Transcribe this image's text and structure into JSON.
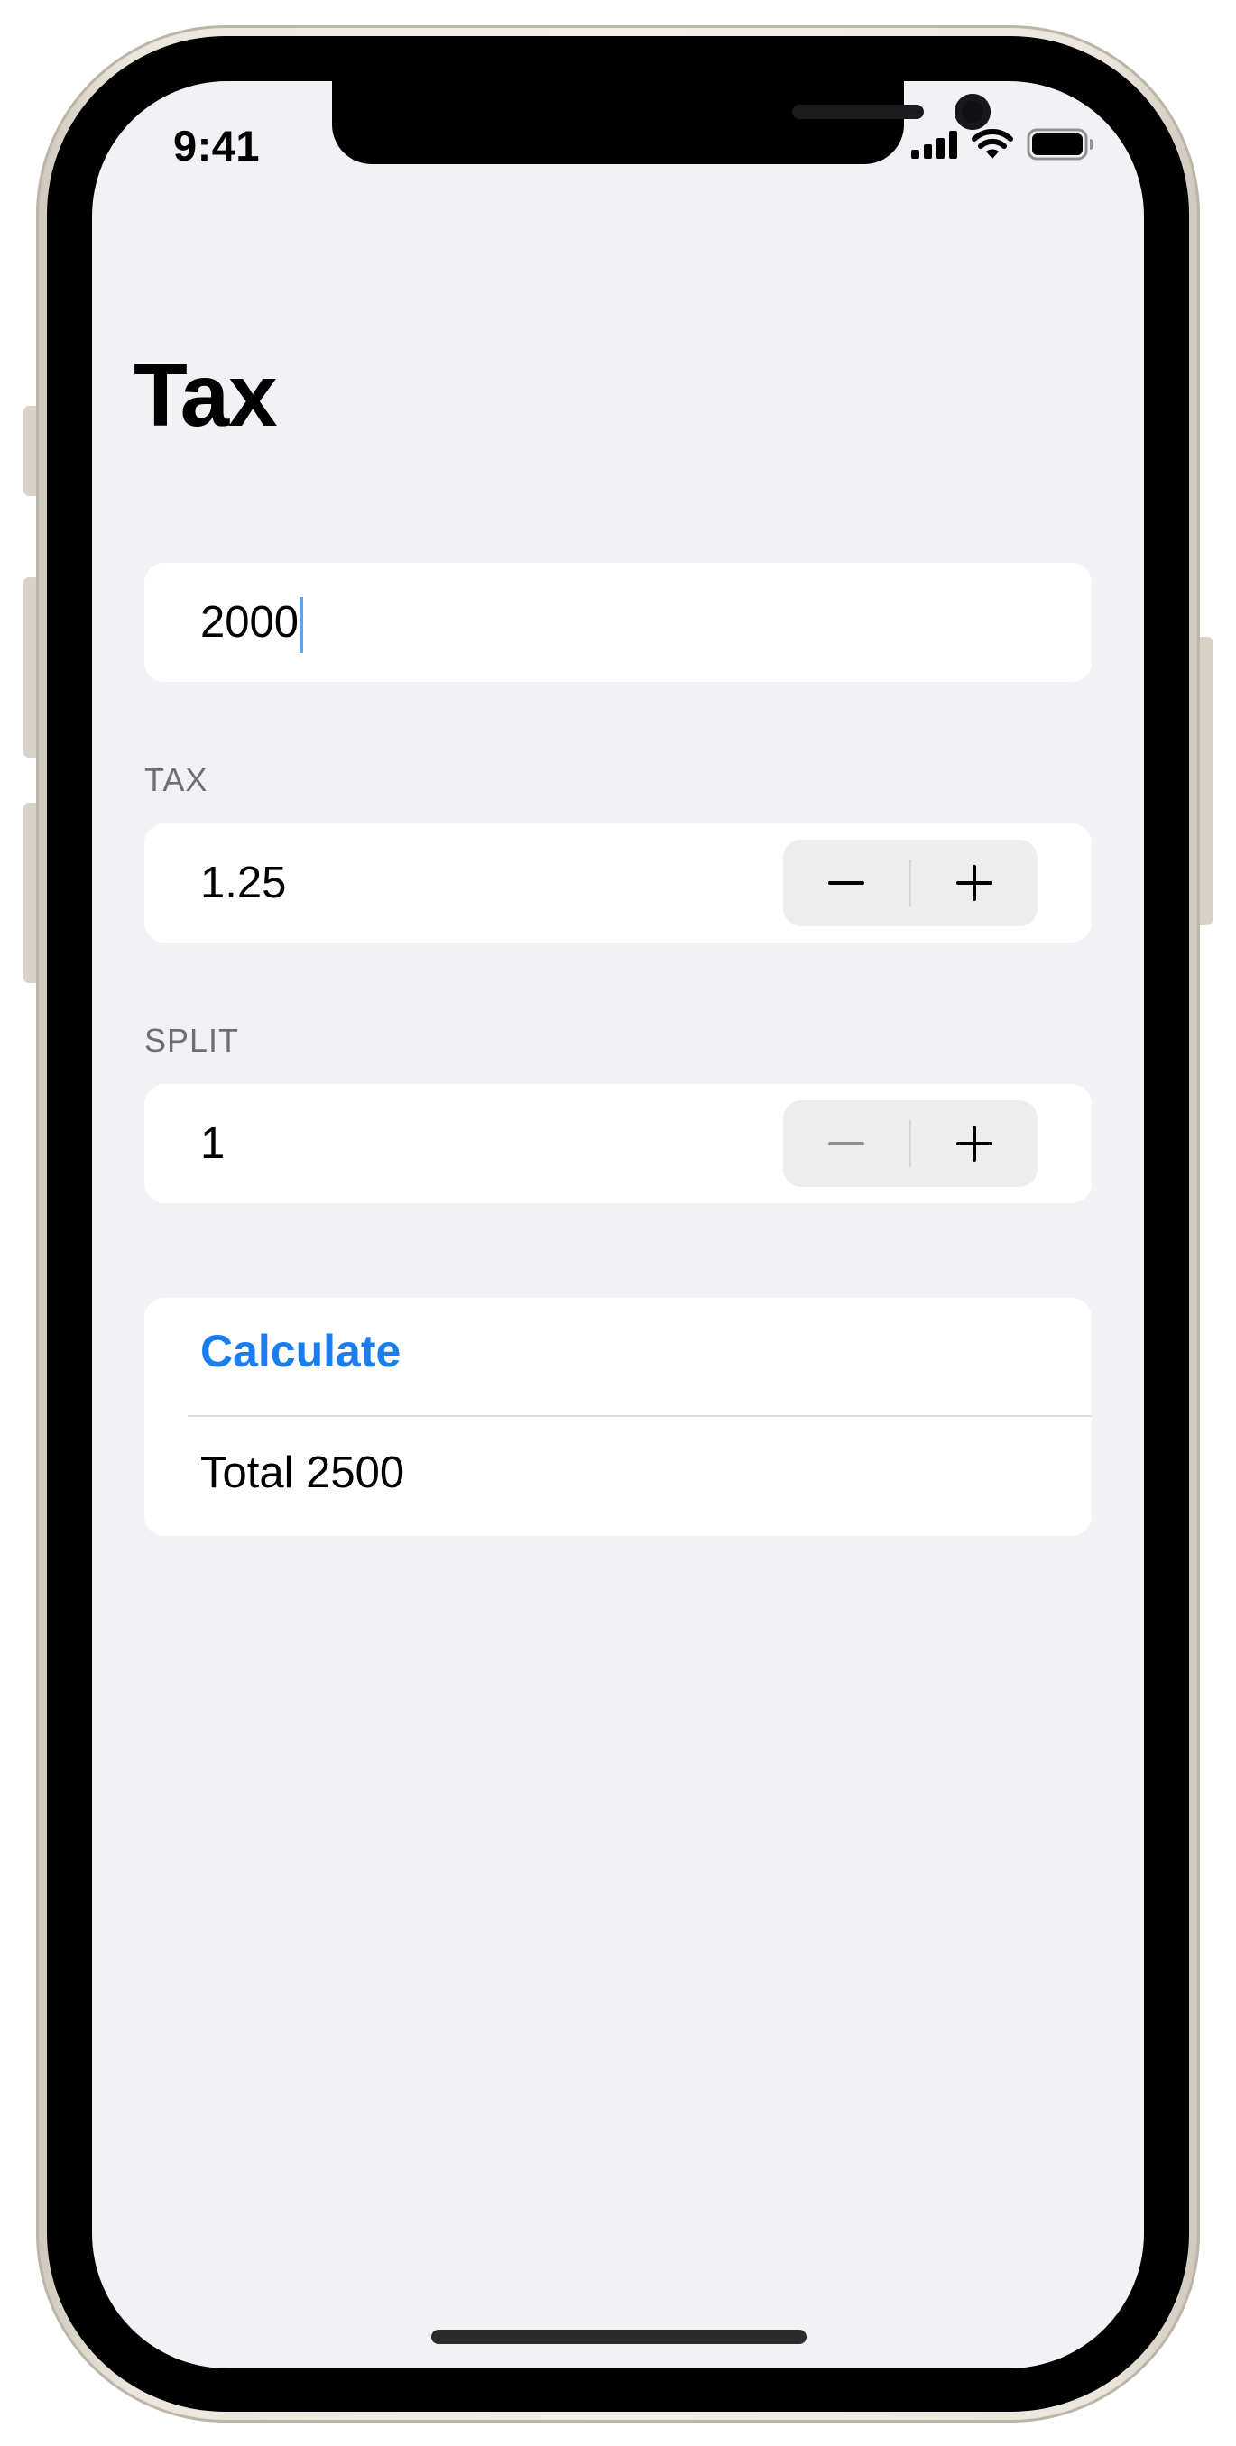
{
  "status_bar": {
    "time": "9:41"
  },
  "nav": {
    "title": "Tax"
  },
  "amount_field": {
    "value": "2000"
  },
  "tax": {
    "section_label": "TAX",
    "value": "1.25",
    "decrement_icon": "minus-icon",
    "increment_icon": "plus-icon"
  },
  "split": {
    "section_label": "SPLIT",
    "value": "1",
    "decrement_enabled": false
  },
  "result": {
    "calculate_label": "Calculate",
    "total_text": "Total 2500"
  },
  "colors": {
    "background": "#f2f2f6",
    "card": "#ffffff",
    "accent": "#1a7ef0",
    "caret": "#5ea3ea"
  }
}
